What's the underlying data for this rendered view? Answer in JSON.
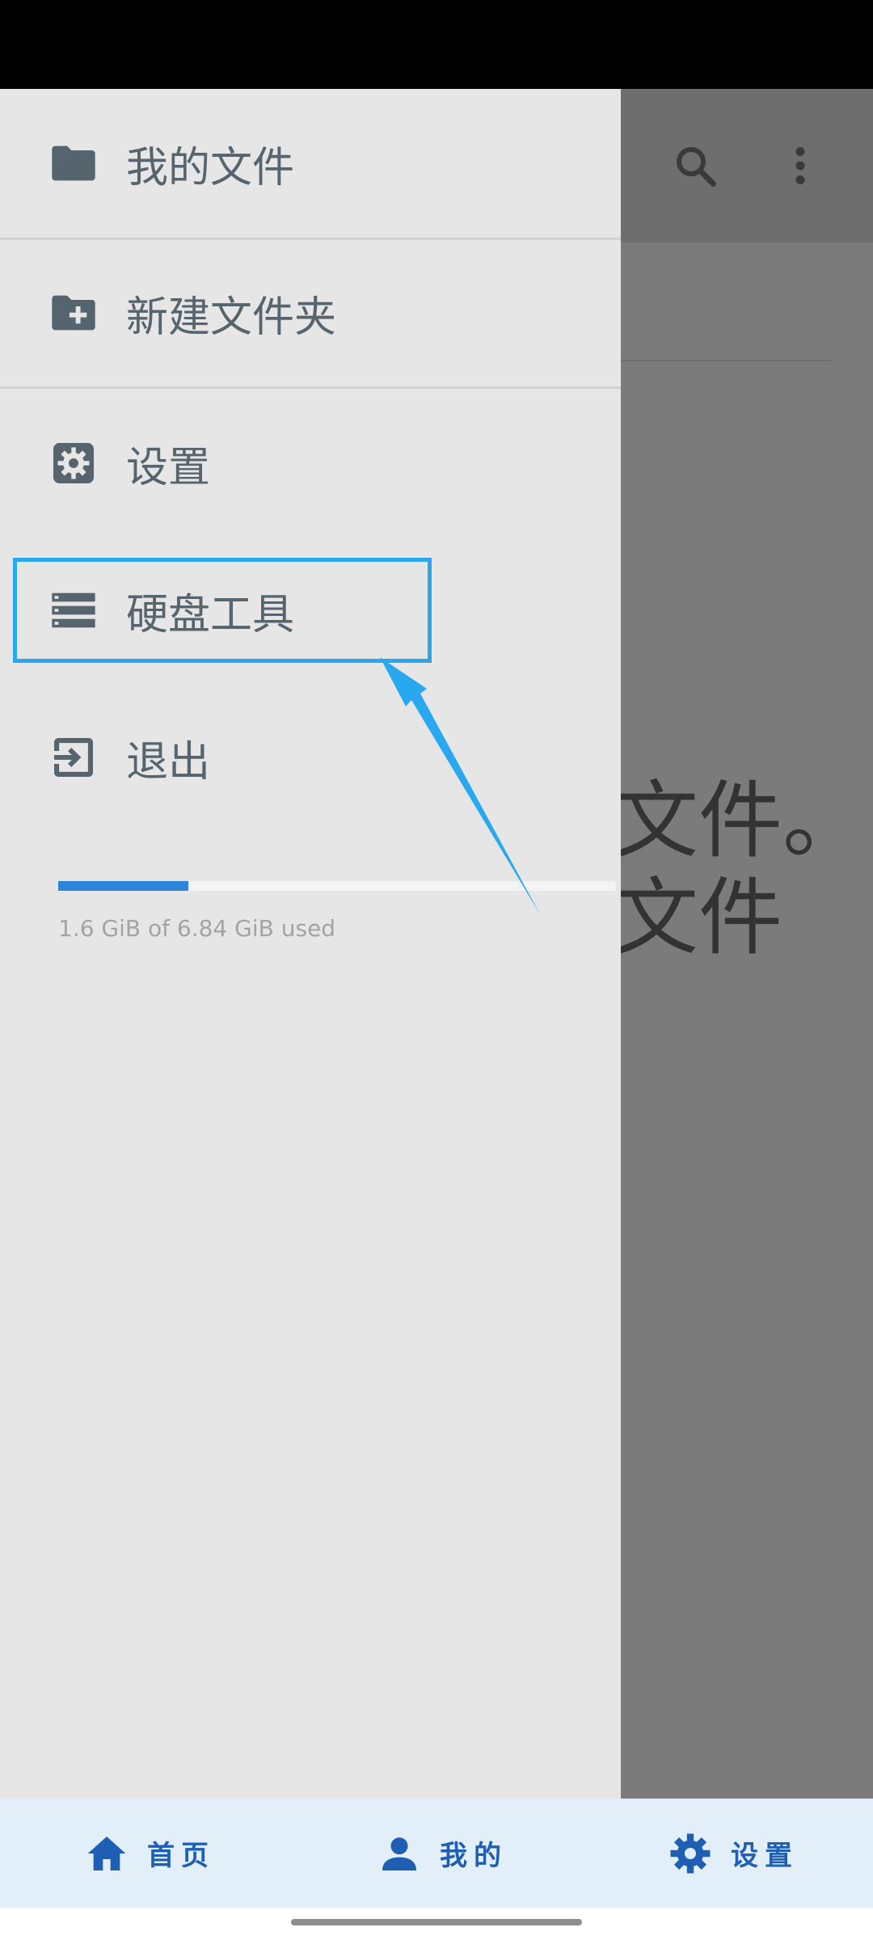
{
  "background": {
    "line1": "文件。",
    "line2": "文件"
  },
  "drawer": {
    "header": {
      "label": "我的文件",
      "icon": "folder-icon"
    },
    "items": [
      {
        "label": "新建文件夹",
        "icon": "folder-plus-icon"
      },
      {
        "label": "设置",
        "icon": "gear-icon"
      },
      {
        "label": "硬盘工具",
        "icon": "storage-icon"
      },
      {
        "label": "退出",
        "icon": "exit-icon"
      }
    ],
    "storage": {
      "used_fraction": 0.234,
      "text": "1.6 GiB of 6.84 GiB used"
    }
  },
  "bottom_nav": {
    "items": [
      {
        "label": "首页",
        "icon": "home-icon"
      },
      {
        "label": "我的",
        "icon": "person-icon"
      },
      {
        "label": "设置",
        "icon": "gear-icon"
      }
    ]
  },
  "colors": {
    "drawer_bg": "#e6e6e6",
    "icon_color": "#55646d",
    "accent_blue": "#29a8f0",
    "nav_blue": "#1f5fb3"
  }
}
